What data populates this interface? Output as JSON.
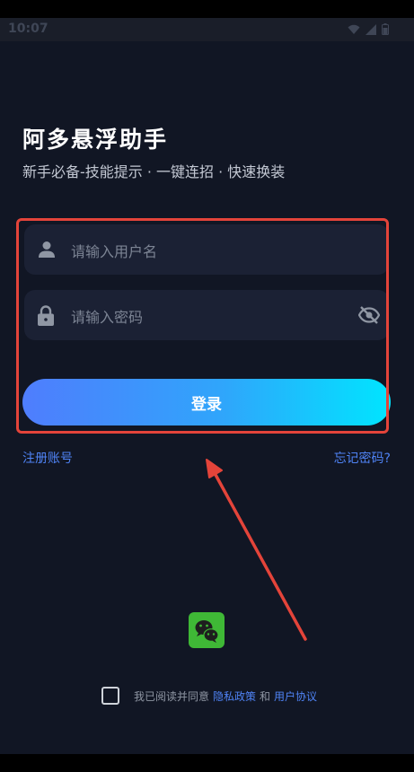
{
  "status": {
    "time": "10:07"
  },
  "app": {
    "title": "阿多悬浮助手",
    "subtitle": "新手必备-技能提示 · 一键连招 · 快速换装"
  },
  "form": {
    "username_placeholder": "请输入用户名",
    "password_placeholder": "请输入密码",
    "login_label": "登录"
  },
  "links": {
    "register": "注册账号",
    "forgot": "忘记密码?"
  },
  "agreement": {
    "prefix": "我已阅读并同意",
    "privacy": "隐私政策",
    "and": "和",
    "terms": "用户协议"
  },
  "colors": {
    "background": "#111624",
    "accent": "#4f83f5",
    "highlight": "#e4443a",
    "wechat": "#3fb836"
  },
  "icons": [
    "person-icon",
    "lock-icon",
    "eye-off-icon",
    "wechat-icon",
    "wifi-icon",
    "signal-icon",
    "battery-icon"
  ]
}
